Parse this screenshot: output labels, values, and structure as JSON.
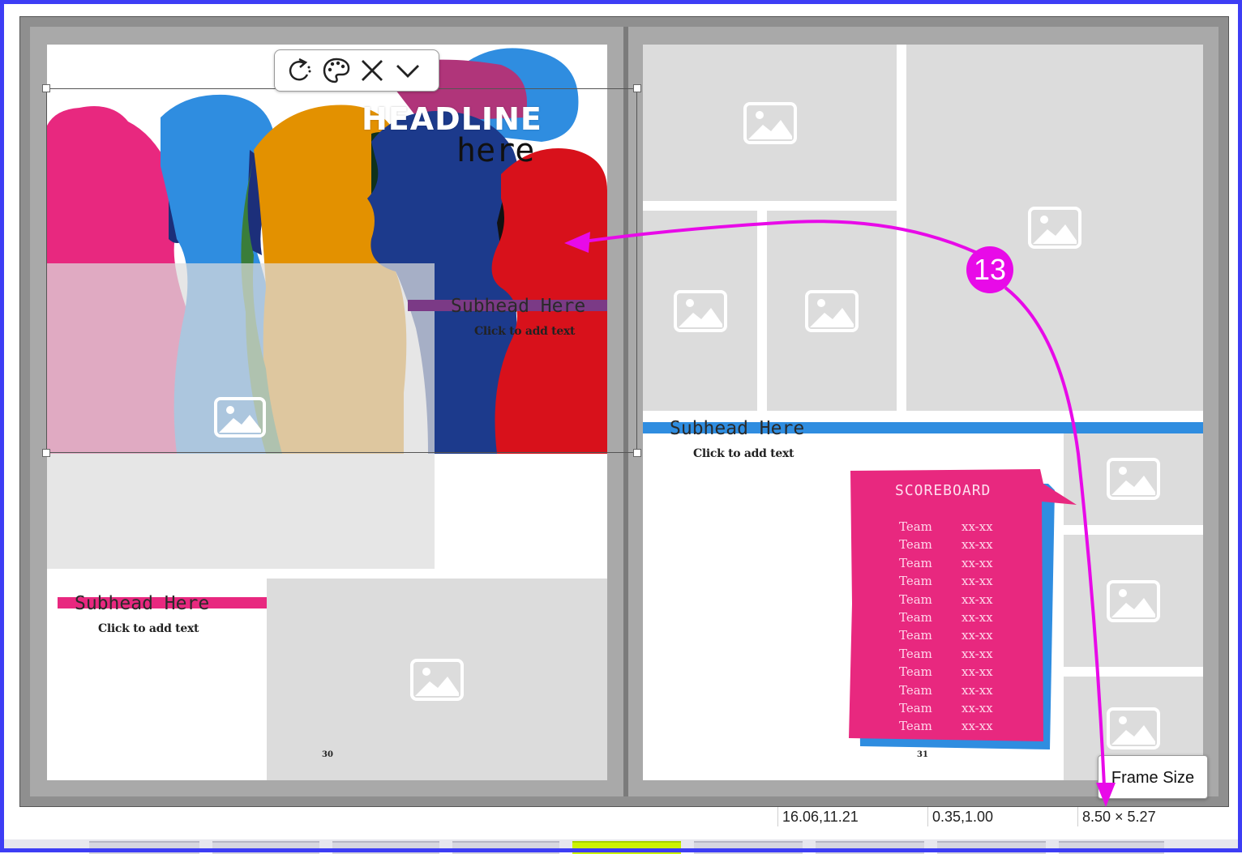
{
  "toolbar": {
    "rotate_icon": "rotate-icon",
    "palette_icon": "palette-icon",
    "close_icon": "close-icon",
    "chevron_icon": "chevron-down-icon"
  },
  "left_page": {
    "headline_line1": "HEADLINE",
    "headline_line2": "here",
    "subhead_top": "Subhead Here",
    "click_top": "Click to add text",
    "subhead_bottom": "Subhead Here",
    "click_bottom": "Click to add text",
    "page_number": "30"
  },
  "right_page": {
    "subhead": "Subhead Here",
    "click": "Click to add text",
    "page_number": "31",
    "scoreboard": {
      "title": "SCOREBOARD",
      "rows": [
        {
          "team": "Team",
          "score": "xx-xx"
        },
        {
          "team": "Team",
          "score": "xx-xx"
        },
        {
          "team": "Team",
          "score": "xx-xx"
        },
        {
          "team": "Team",
          "score": "xx-xx"
        },
        {
          "team": "Team",
          "score": "xx-xx"
        },
        {
          "team": "Team",
          "score": "xx-xx"
        },
        {
          "team": "Team",
          "score": "xx-xx"
        },
        {
          "team": "Team",
          "score": "xx-xx"
        },
        {
          "team": "Team",
          "score": "xx-xx"
        },
        {
          "team": "Team",
          "score": "xx-xx"
        },
        {
          "team": "Team",
          "score": "xx-xx"
        },
        {
          "team": "Team",
          "score": "xx-xx"
        }
      ]
    }
  },
  "annotation": {
    "badge": "13"
  },
  "tooltip": {
    "label": "Frame Size"
  },
  "statusbar": {
    "position": "16.06,11.21",
    "offset": "0.35,1.00",
    "frame_size": "8.50 × 5.27"
  },
  "colors": {
    "accent_magenta": "#e80ae8",
    "pink": "#e8287f",
    "blue": "#2f8de0",
    "purple": "#7b3a86"
  }
}
